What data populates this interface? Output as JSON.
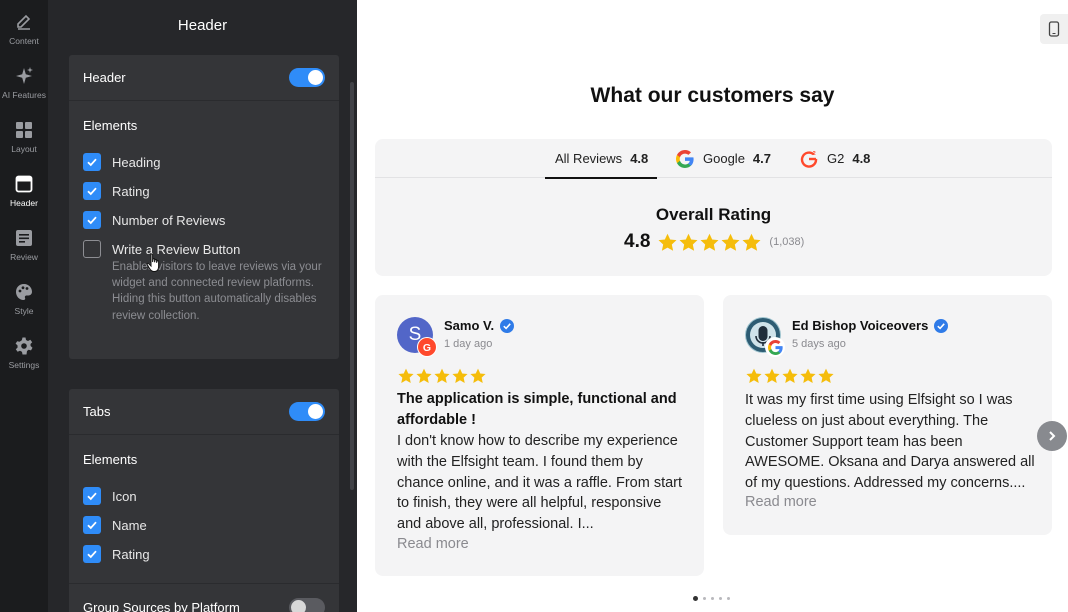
{
  "rail": {
    "items": [
      {
        "label": "Content",
        "icon": "pencil-icon"
      },
      {
        "label": "AI Features",
        "icon": "sparkle-icon"
      },
      {
        "label": "Layout",
        "icon": "layout-icon"
      },
      {
        "label": "Header",
        "icon": "header-icon",
        "active": true
      },
      {
        "label": "Review",
        "icon": "review-icon"
      },
      {
        "label": "Style",
        "icon": "palette-icon"
      },
      {
        "label": "Settings",
        "icon": "gear-icon"
      }
    ]
  },
  "panel": {
    "title": "Header",
    "header_card": {
      "title": "Header",
      "toggle_on": true,
      "section": "Elements",
      "items": [
        {
          "label": "Heading",
          "checked": true
        },
        {
          "label": "Rating",
          "checked": true
        },
        {
          "label": "Number of Reviews",
          "checked": true
        },
        {
          "label": "Write a Review Button",
          "checked": false
        }
      ],
      "hint": "Enables visitors to leave reviews via your widget and connected review platforms. Hiding this button automatically disables review collection."
    },
    "tabs_card": {
      "title": "Tabs",
      "toggle_on": true,
      "section": "Elements",
      "items": [
        {
          "label": "Icon",
          "checked": true
        },
        {
          "label": "Name",
          "checked": true
        },
        {
          "label": "Rating",
          "checked": true
        }
      ],
      "group_label": "Group Sources by Platform",
      "group_toggle_on": false
    }
  },
  "preview": {
    "heading": "What our customers say",
    "tabs": [
      {
        "label": "All Reviews",
        "score": "4.8",
        "icon": "",
        "active": true
      },
      {
        "label": "Google",
        "score": "4.7",
        "icon": "google-icon"
      },
      {
        "label": "G2",
        "score": "4.8",
        "icon": "g2-icon"
      }
    ],
    "overall": {
      "title": "Overall Rating",
      "score": "4.8",
      "count": "(1,038)",
      "stars": 5
    },
    "reviews": [
      {
        "name": "Samo V.",
        "avatar_letter": "S",
        "avatar_color": "#5266c8",
        "platform_icon": "g2-icon",
        "date": "1 day ago",
        "stars": 5,
        "title": "The application is simple, functional and affordable !",
        "body": "I don't know how to describe my experience with the Elfsight team. I found them by chance online, and it was a raffle. From start to finish, they were all helpful, responsive and above all, professional. I...",
        "more": "Read more"
      },
      {
        "name": "Ed Bishop Voiceovers",
        "avatar_letter": "",
        "avatar_color": "#4a7f95",
        "platform_icon": "google-icon",
        "date": "5 days ago",
        "stars": 5,
        "title": "",
        "body": "It was my first time using Elfsight so I was clueless on just about everything. The Customer Support team has been AWESOME. Oksana and Darya answered all of my questions. Addressed my concerns....",
        "more": "Read more"
      }
    ],
    "pagination": {
      "pages": 5,
      "active": 1
    },
    "colors": {
      "accent": "#2f8cf8",
      "star": "#f5bd0b",
      "verified": "#2f7be8"
    }
  }
}
